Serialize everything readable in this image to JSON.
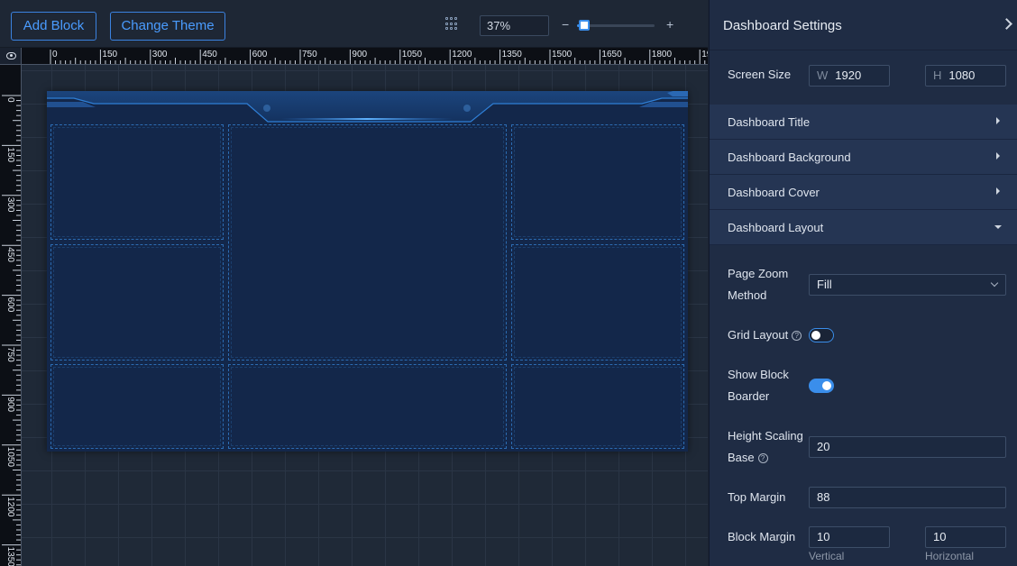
{
  "toolbar": {
    "add_block": "Add Block",
    "change_theme": "Change Theme",
    "grid_icon": "grid-icon",
    "zoom_value": "37%",
    "zoom_minus": "−",
    "zoom_plus": "+",
    "zoom_slider_fraction": 0.1
  },
  "rulers": {
    "top_labels": [
      "0",
      "150",
      "300",
      "450",
      "600",
      "750",
      "900",
      "1050",
      "1200",
      "1350",
      "1500",
      "1650",
      "1800",
      "19"
    ],
    "left_labels": [
      "0",
      "150",
      "300",
      "450",
      "600",
      "750",
      "900",
      "1050",
      "1200",
      "1350"
    ]
  },
  "panel": {
    "title": "Dashboard Settings",
    "screen_size_label": "Screen Size",
    "width_prefix": "W",
    "width_value": "1920",
    "height_prefix": "H",
    "height_value": "1080",
    "sections": [
      {
        "title": "Dashboard Title",
        "state": "collapsed"
      },
      {
        "title": "Dashboard Background",
        "state": "collapsed"
      },
      {
        "title": "Dashboard Cover",
        "state": "collapsed"
      },
      {
        "title": "Dashboard Layout",
        "state": "expanded"
      }
    ],
    "page_zoom_label_1": "Page Zoom",
    "page_zoom_label_2": "Method",
    "page_zoom_value": "Fill",
    "grid_layout_label": "Grid Layout",
    "grid_layout_on": false,
    "show_block_label_1": "Show Block",
    "show_block_label_2": "Boarder",
    "show_block_on": true,
    "height_scaling_label_1": "Height Scaling",
    "height_scaling_label_2": "Base",
    "height_scaling_value": "20",
    "top_margin_label": "Top Margin",
    "top_margin_value": "88",
    "block_margin_label": "Block Margin",
    "block_margin_vertical": "10",
    "block_margin_horizontal": "10",
    "vertical_label": "Vertical",
    "horizontal_label": "Horizontal"
  },
  "colors": {
    "accent": "#3a8eeb",
    "board_bg": "#13274a",
    "panel_bg": "#1f2c44"
  }
}
